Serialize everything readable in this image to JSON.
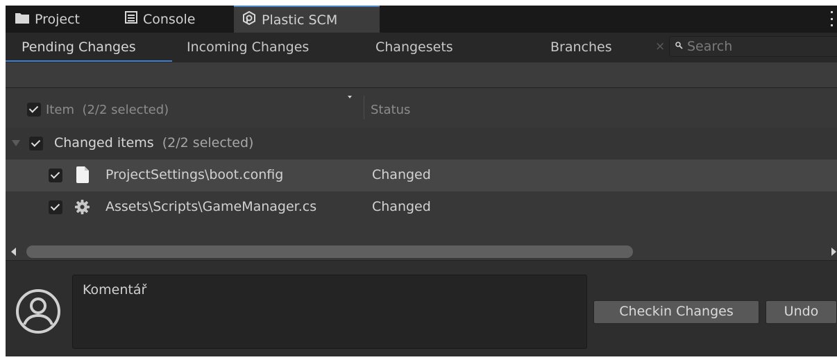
{
  "window_tabs": [
    {
      "label": "Project",
      "icon": "folder-icon"
    },
    {
      "label": "Console",
      "icon": "console-icon"
    },
    {
      "label": "Plastic SCM",
      "icon": "plastic-scm-icon",
      "active": true
    }
  ],
  "view_tabs": [
    {
      "label": "Pending Changes",
      "active": true
    },
    {
      "label": "Incoming Changes"
    },
    {
      "label": "Changesets"
    },
    {
      "label": "Branches"
    }
  ],
  "search": {
    "placeholder": "Search",
    "clear_label": "×"
  },
  "table": {
    "header": {
      "item": "Item",
      "item_count": "(2/2 selected)",
      "status": "Status"
    },
    "group": {
      "label": "Changed items",
      "count": "(2/2 selected)"
    },
    "rows": [
      {
        "name": "ProjectSettings\\boot.config",
        "status": "Changed",
        "icon": "file-icon",
        "checked": true
      },
      {
        "name": "Assets\\Scripts\\GameManager.cs",
        "status": "Changed",
        "icon": "gear-icon",
        "checked": true
      }
    ]
  },
  "comment": {
    "placeholder": "Komentář"
  },
  "buttons": {
    "checkin": "Checkin Changes",
    "undo": "Undo"
  },
  "colors": {
    "accent": "#3d7fd0",
    "background": "#383838",
    "selected_row": "#464646"
  }
}
